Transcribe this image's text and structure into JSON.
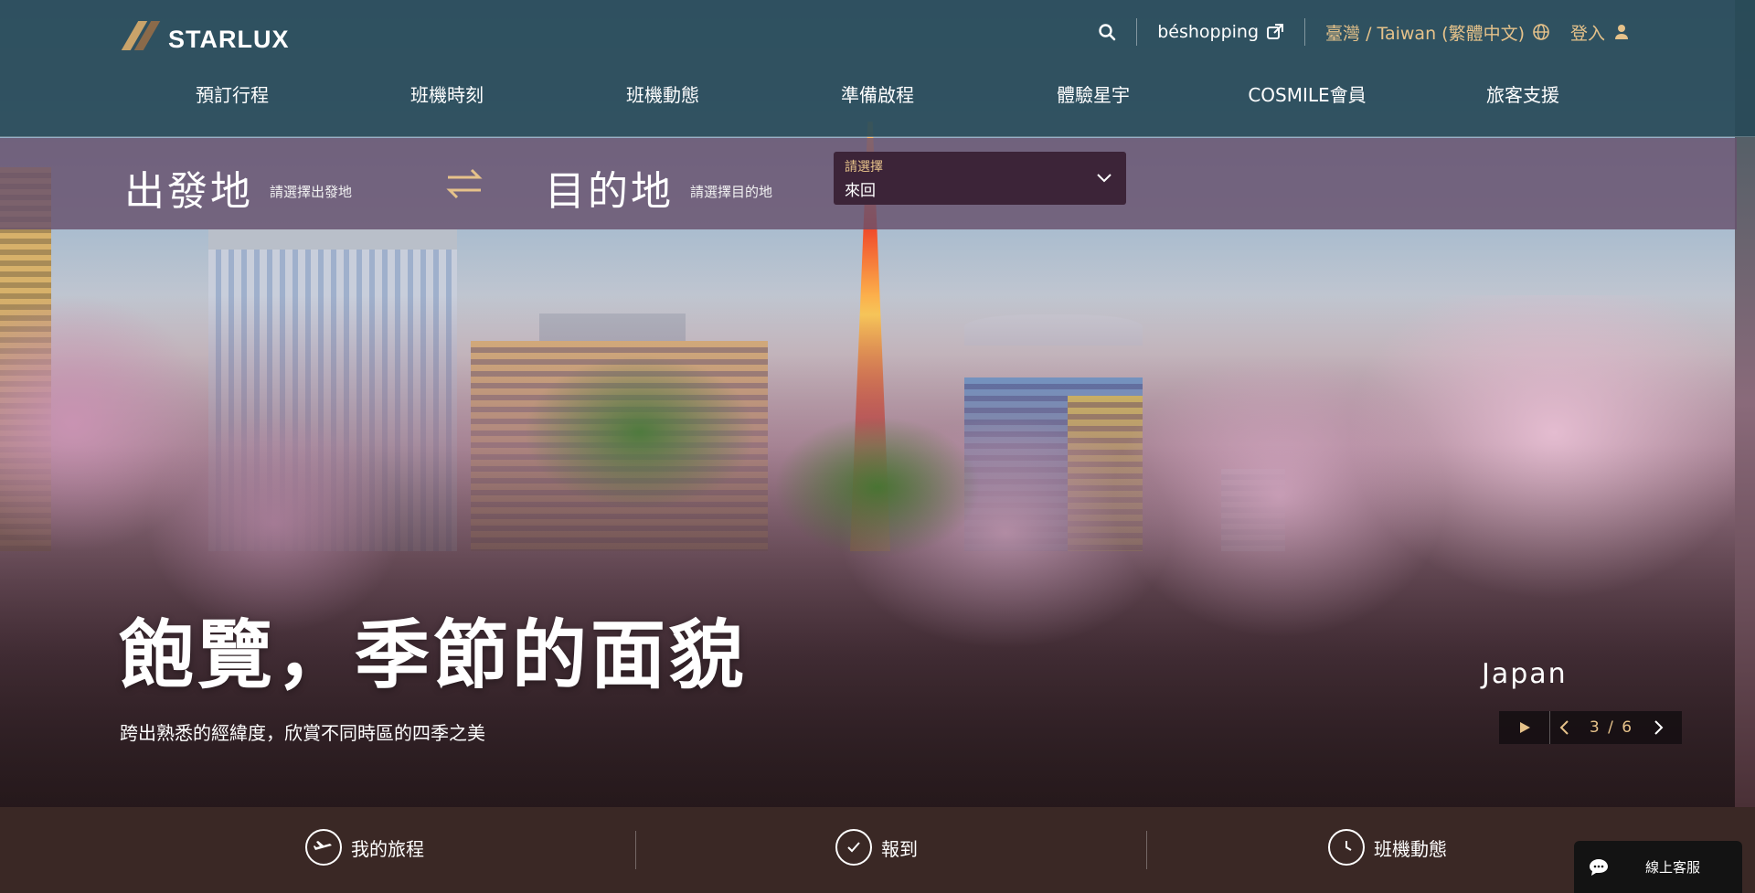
{
  "brand": {
    "name": "STARLUX"
  },
  "utility": {
    "shopping": "béshopping",
    "language": "臺灣 / Taiwan (繁體中文)",
    "login": "登入"
  },
  "nav": {
    "items": [
      {
        "label": "預訂行程"
      },
      {
        "label": "班機時刻"
      },
      {
        "label": "班機動態"
      },
      {
        "label": "準備啟程"
      },
      {
        "label": "體驗星宇"
      },
      {
        "label": "COSMILE會員"
      },
      {
        "label": "旅客支援"
      }
    ]
  },
  "booking": {
    "origin_label": "出發地",
    "origin_hint": "請選擇出發地",
    "destination_label": "目的地",
    "destination_hint": "請選擇目的地",
    "trip_type_label": "請選擇",
    "trip_type_value": "來回"
  },
  "hero": {
    "title": "飽覽，季節的面貌",
    "subtitle": "跨出熟悉的經緯度，欣賞不同時區的四季之美",
    "place": "Japan",
    "slide_counter": "3 / 6"
  },
  "quickbar": {
    "my_trip": "我的旅程",
    "checkin": "報到",
    "flight_status": "班機動態"
  },
  "chat": {
    "label": "線上客服"
  },
  "colors": {
    "accent_gold": "#e6c28a",
    "nav_bg": "#284a58",
    "booking_bg": "#68506c",
    "footer_bg": "#3a2825"
  }
}
